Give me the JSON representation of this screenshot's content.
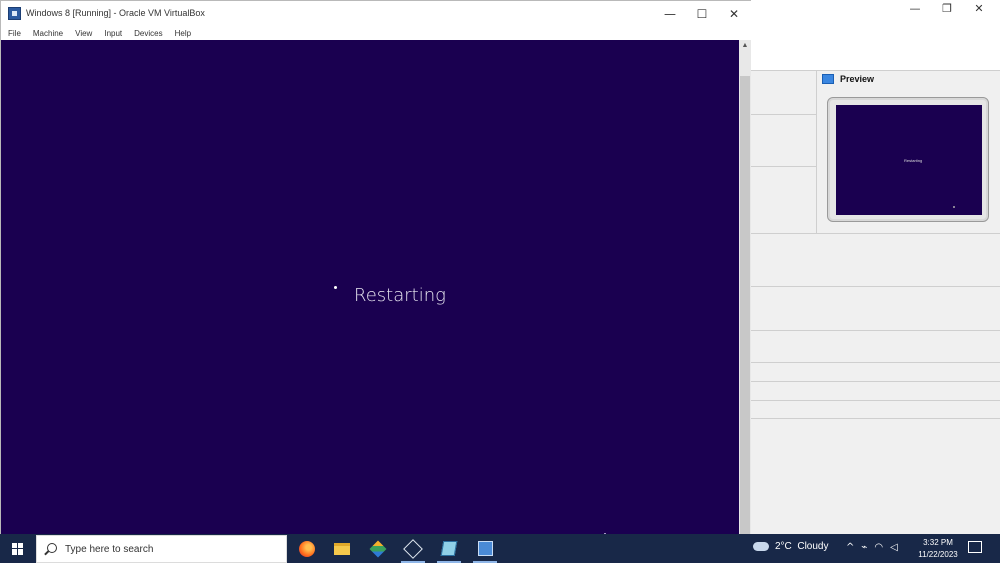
{
  "vm_window": {
    "title": "Windows 8 [Running] - Oracle VM VirtualBox",
    "controls": {
      "minimize": "—",
      "maximize": "☐",
      "close": "✕"
    },
    "menu": [
      "File",
      "Machine",
      "View",
      "Input",
      "Devices",
      "Help"
    ],
    "screen": {
      "status_text": "Restarting",
      "background_color": "#1a0050"
    }
  },
  "manager_window": {
    "controls": {
      "minimize": "—",
      "restore": "❐",
      "close": "✕"
    },
    "preview": {
      "title": "Preview",
      "screen_text": "Restarting"
    }
  },
  "taskbar": {
    "search_placeholder": "Type here to search",
    "apps": [
      "firefox-icon",
      "file-explorer-icon",
      "layers-app-icon",
      "virtualbox-cube-icon",
      "book-app-icon",
      "virtualbox-vm-icon"
    ],
    "weather": {
      "temperature": "2°C",
      "condition": "Cloudy"
    },
    "tray": {
      "chevron": "^",
      "network": "⌁",
      "wifi": "◠",
      "volume": "◁"
    },
    "clock": {
      "time": "3:32 PM",
      "date": "11/22/2023"
    }
  }
}
